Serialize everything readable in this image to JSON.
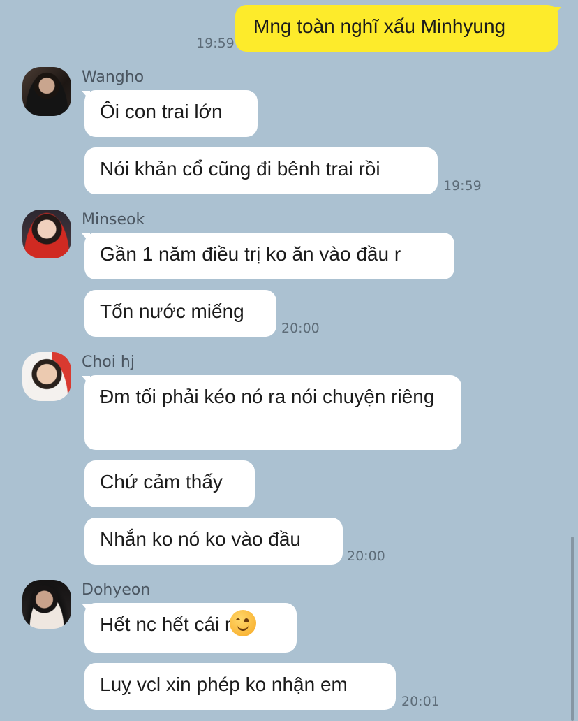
{
  "messages": {
    "out1": {
      "text": "Mng toàn nghĩ xấu Minhyung",
      "time": "19:59"
    },
    "wangho": {
      "name": "Wangho",
      "b1": "Ôi con trai lớn",
      "b2": "Nói khản cổ cũng đi bênh trai rồi",
      "time": "19:59"
    },
    "minseok": {
      "name": "Minseok",
      "b1": "Gần 1 năm điều trị ko ăn vào đầu r",
      "b2": "Tốn nước miếng",
      "time": "20:00"
    },
    "choi": {
      "name": "Choi hj",
      "b1": "Đm tối phải kéo nó ra nói chuyện riêng",
      "b2": "Chứ cảm thấy",
      "b3": "Nhắn ko nó ko vào đầu",
      "time": "20:00"
    },
    "dohyeon": {
      "name": "Dohyeon",
      "b1": "Hết nc hết cái r",
      "b1_emoji": "hugging-face-emoji",
      "b2": "Luỵ vcl xin phép ko nhận em",
      "time": "20:01"
    }
  },
  "colors": {
    "background": "#abc1d1",
    "incoming_bubble": "#ffffff",
    "outgoing_bubble": "#fdeb2b"
  }
}
